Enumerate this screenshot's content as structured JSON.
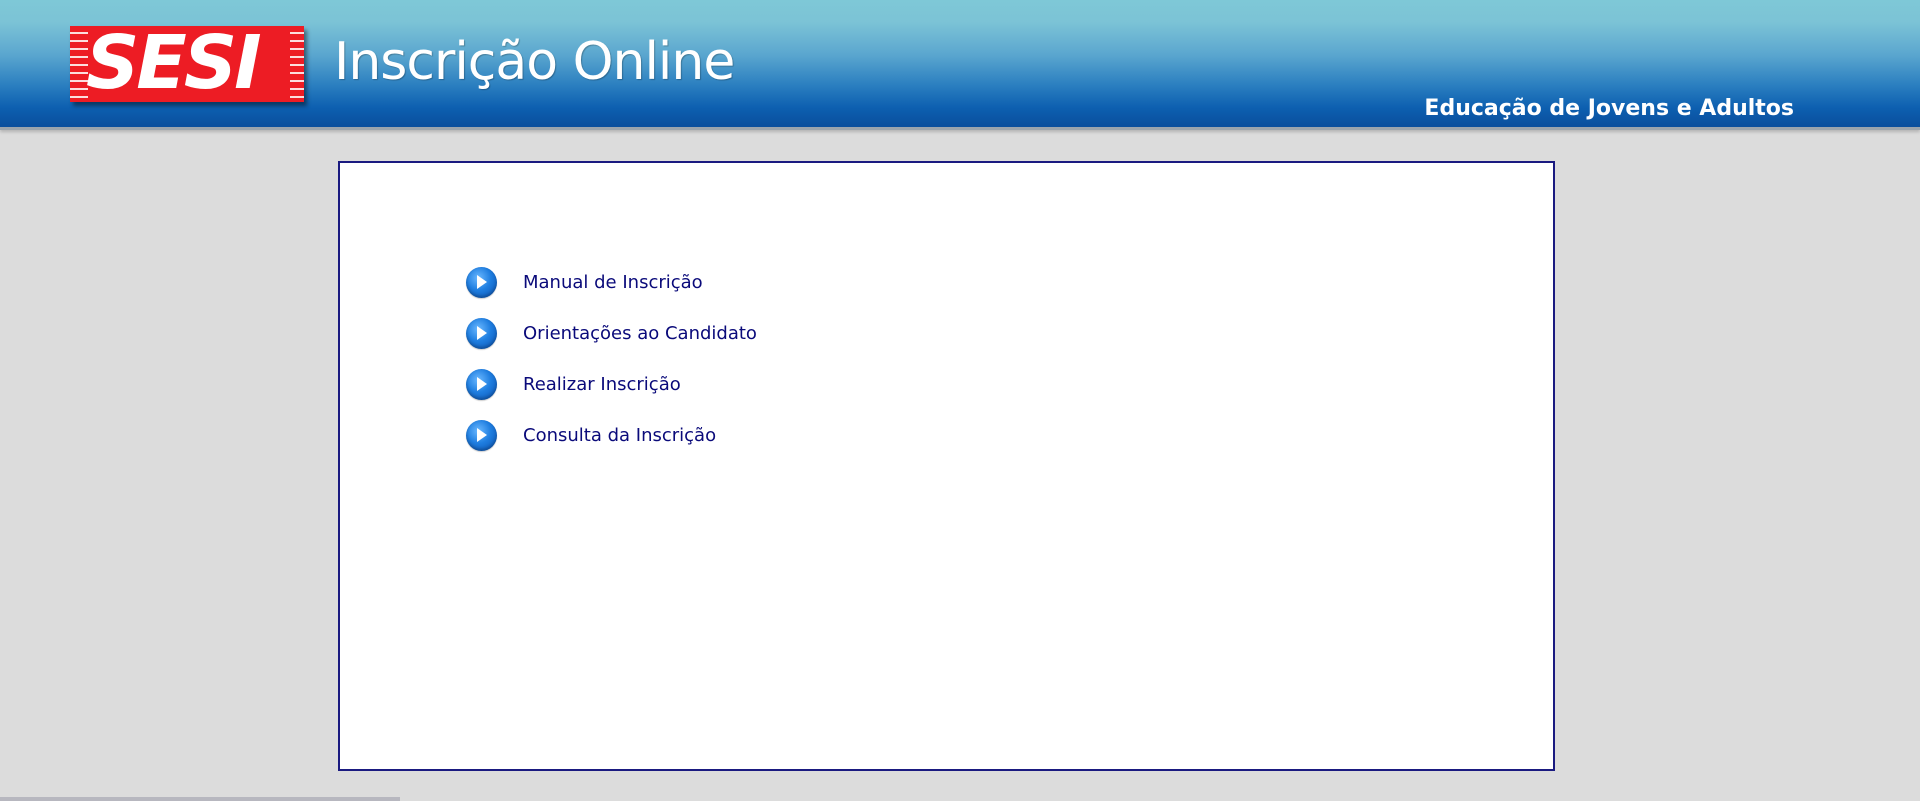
{
  "header": {
    "logo_text": "SESI",
    "app_title": "Inscrição Online",
    "subtitle": "Educação de Jovens e Adultos"
  },
  "menu": {
    "items": [
      {
        "label": "Manual de Inscrição",
        "icon": "arrow-right-icon"
      },
      {
        "label": "Orientações ao Candidato",
        "icon": "arrow-right-icon"
      },
      {
        "label": "Realizar Inscrição",
        "icon": "arrow-right-icon"
      },
      {
        "label": "Consulta da Inscrição",
        "icon": "arrow-right-icon"
      }
    ]
  },
  "colors": {
    "header_top": "#7ec8d7",
    "header_bottom": "#0a4f9e",
    "logo_red": "#ed1c24",
    "link": "#0a0a7a",
    "panel_border": "#1a1a80",
    "background": "#dcdcdc"
  }
}
